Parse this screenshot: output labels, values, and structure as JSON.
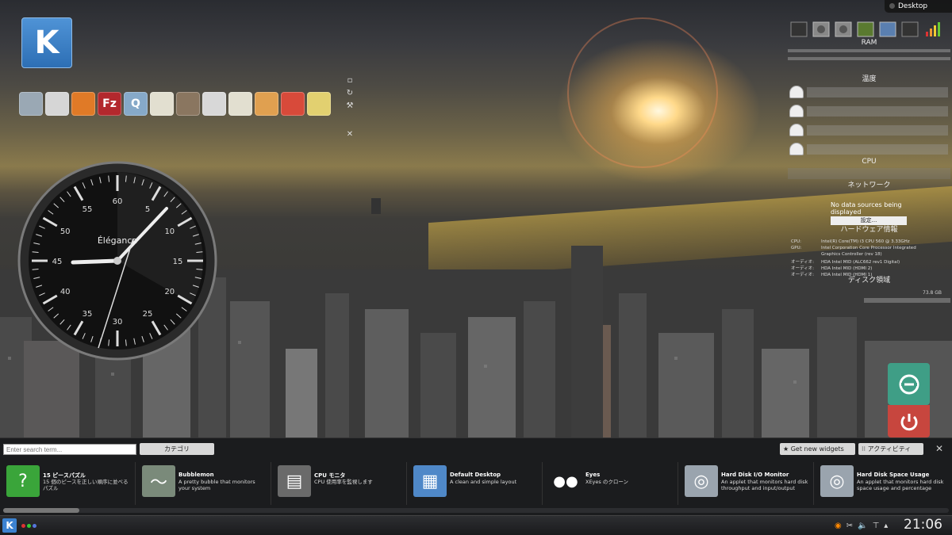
{
  "topbar": {
    "label": "Desktop"
  },
  "quicklaunch": [
    {
      "name": "file-manager",
      "glyph": "",
      "bg": "#9aa8b4"
    },
    {
      "name": "chrome",
      "glyph": "",
      "bg": "#d6d6d6"
    },
    {
      "name": "firefox",
      "glyph": "",
      "bg": "#e07a27"
    },
    {
      "name": "filezilla",
      "glyph": "Fz",
      "bg": "#b3282d"
    },
    {
      "name": "app-q",
      "glyph": "Q",
      "bg": "#86a9c8"
    },
    {
      "name": "notes",
      "glyph": "",
      "bg": "#e2dfd0"
    },
    {
      "name": "gimp",
      "glyph": "",
      "bg": "#8a7660"
    },
    {
      "name": "inkscape",
      "glyph": "",
      "bg": "#d8d8d8"
    },
    {
      "name": "notes2",
      "glyph": "",
      "bg": "#e2dfd0"
    },
    {
      "name": "media-disc",
      "glyph": "",
      "bg": "#e0a050"
    },
    {
      "name": "settings",
      "glyph": "",
      "bg": "#d84a3a"
    },
    {
      "name": "downloader",
      "glyph": "",
      "bg": "#e2d070"
    }
  ],
  "clock": {
    "brand": "Élégance",
    "numbers": [
      "60",
      "5",
      "10",
      "15",
      "20",
      "25",
      "30",
      "35",
      "40",
      "45",
      "50",
      "55"
    ]
  },
  "sysmon": {
    "ram_label": "RAM",
    "temp_label": "温度",
    "cpu_label": "CPU",
    "net_label": "ネットワーク",
    "net_no_data": "No data sources being displayed",
    "net_settings": "設定...",
    "hw_label": "ハードウェア情報",
    "hw_rows": [
      {
        "k": "CPU:",
        "v": "Intel(R) Core(TM) i3 CPU 560 @ 3.33GHz"
      },
      {
        "k": "GPU:",
        "v": "Intel Corporation Core Processor Integrated"
      },
      {
        "k": "",
        "v": "Graphics Controller (rev 18)"
      },
      {
        "k": "オーディオ:",
        "v": "HDA Intel MID (ALC662 rev1 Digital)"
      },
      {
        "k": "オーディオ:",
        "v": "HDA Intel MID (HDMI 2)"
      },
      {
        "k": "オーディオ:",
        "v": "HDA Intel MID (HDMI 1)"
      }
    ],
    "disk_label": "ディスク領域",
    "disk_size": "73.8 GB"
  },
  "explorer": {
    "search_placeholder": "Enter search term...",
    "category": "カテゴリ",
    "get_widgets": "Get new widgets",
    "activities": "アクティビティ",
    "widgets": [
      {
        "title": "15 ピースパズル",
        "desc": "15 個のピースを正しい順序に並べるパズル"
      },
      {
        "title": "Bubblemon",
        "desc": "A pretty bubble that monitors your system"
      },
      {
        "title": "CPU モニタ",
        "desc": "CPU 使用率を監視します"
      },
      {
        "title": "Default Desktop",
        "desc": "A clean and simple layout"
      },
      {
        "title": "Eyes",
        "desc": "XEyes のクローン"
      },
      {
        "title": "Hard Disk I/O Monitor",
        "desc": "An applet that monitors hard disk throughput and input/output"
      },
      {
        "title": "Hard Disk Space Usage",
        "desc": "An applet that monitors hard disk space usage and percentage"
      }
    ]
  },
  "taskbar": {
    "time": "21:06"
  }
}
